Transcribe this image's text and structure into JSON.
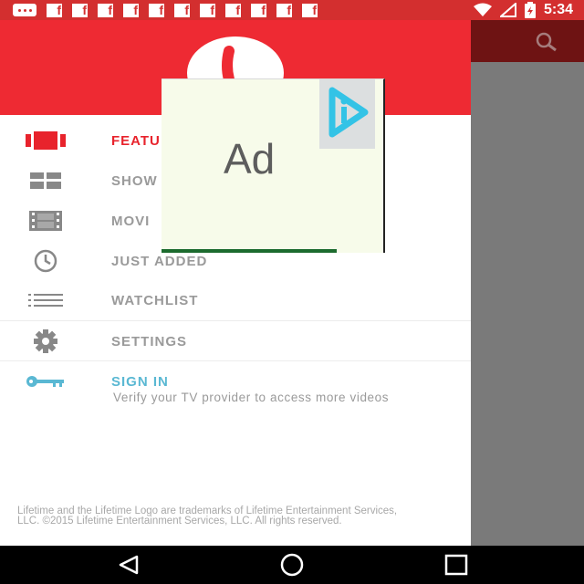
{
  "status_bar": {
    "time": "5:34",
    "notification_icons": [
      "more-icon",
      "facebook-icon",
      "facebook-icon",
      "facebook-icon",
      "facebook-icon",
      "facebook-icon",
      "facebook-icon",
      "facebook-icon",
      "facebook-icon",
      "facebook-icon",
      "facebook-icon",
      "facebook-icon"
    ],
    "facebook_glyph": "f"
  },
  "drawer": {
    "menu": [
      {
        "label": "FEATU",
        "icon": "film-strip-icon",
        "active": true
      },
      {
        "label": "SHOW",
        "icon": "grid-icon"
      },
      {
        "label": "MOVI",
        "icon": "film-icon"
      },
      {
        "label": "JUST ADDED",
        "icon": "clock-icon"
      },
      {
        "label": "WATCHLIST",
        "icon": "list-icon"
      },
      {
        "label": "SETTINGS",
        "icon": "gear-icon"
      },
      {
        "label": "SIGN IN",
        "icon": "key-icon",
        "subtitle": "Verify your TV provider to access more videos"
      }
    ],
    "legal": "Lifetime and the Lifetime Logo are trademarks of Lifetime Entertainment Services, LLC. ©2015 Lifetime Entertainment Services, LLC. All rights reserved."
  },
  "ad": {
    "label": "Ad"
  },
  "colors": {
    "status_bar": "#d32f2f",
    "drawer_header": "#ee2a33",
    "active": "#e8232c",
    "sign_in": "#5ab8d3",
    "scrim": "#7a7a7a"
  }
}
